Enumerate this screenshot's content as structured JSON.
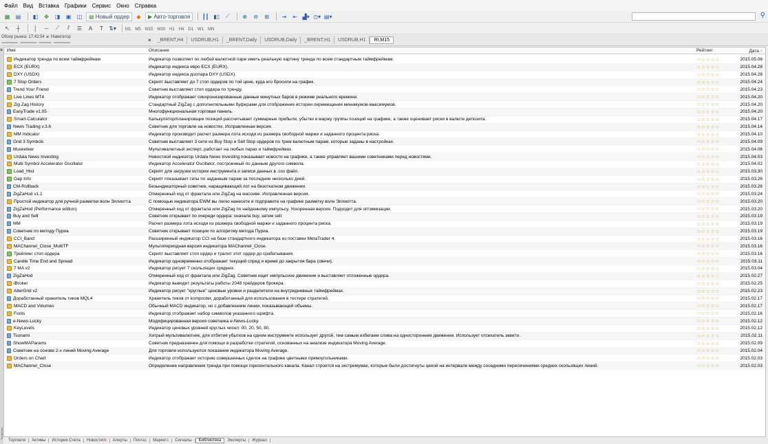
{
  "menu": [
    "Файл",
    "Вид",
    "Вставка",
    "Графики",
    "Сервис",
    "Окно",
    "Справка"
  ],
  "toolbar": {
    "new_order": "Новый ордер",
    "autotrading": "Авто-торговля"
  },
  "timeframes": [
    "M1",
    "M5",
    "M15",
    "M30",
    "H1",
    "H4",
    "D1",
    "W1",
    "MN"
  ],
  "panels": {
    "market_watch": "Обзор рынка: 17:42:54",
    "navigator": "Навигатор"
  },
  "chart_tabs": [
    "_BRENT,H4",
    "USDRUB,H1",
    "_BRENT,Daily",
    "USDRUB,Daily",
    "_BRENT,H1",
    "USDRUB,H1",
    "RI,M15"
  ],
  "table": {
    "headers": {
      "name": "Имя",
      "desc": "Описание",
      "rating": "Рейтинг",
      "date": "Дата"
    },
    "rating_stars": "☆☆☆☆☆",
    "rows": [
      {
        "type": "indicator",
        "name": "Индикатор тренда по всем таймфреймам",
        "desc": "Индикатор позволяет по любой валютной паре иметь реальную картину тренда по всем стандартным таймфреймам.",
        "date": "2015.05.06"
      },
      {
        "type": "indicator",
        "name": "ECX (EURX)",
        "desc": "Индикатор индекса евро ECX (EURX).",
        "date": "2015.04.28"
      },
      {
        "type": "indicator",
        "name": "DXY (USDX)",
        "desc": "Индикатор индекса доллара DXY (USDX).",
        "date": "2015.04.28"
      },
      {
        "type": "script",
        "name": "7 Stop Orders",
        "desc": "Скрипт выставляет до 7 стоп ордеров по той цене, куда его бросили на график.",
        "date": "2015.04.24"
      },
      {
        "type": "expert",
        "name": "Trend Your Friend",
        "desc": "Советник выставляет стоп ордера по тренду.",
        "date": "2015.04.23"
      },
      {
        "type": "indicator",
        "name": "Live Lines MT4",
        "desc": "Индикатор отображает синхронизированные данные минутных баров в режиме реального времени.",
        "date": "2015.04.20"
      },
      {
        "type": "indicator",
        "name": "Zig Zag History",
        "desc": "Стандартный ZigZag с дополнительными буферами для отображения истории перемещения минимумов-максимумов.",
        "date": "2015.04.20"
      },
      {
        "type": "expert",
        "name": "EasyTrade v1.05",
        "desc": "Многофункциональная торговая панель.",
        "date": "2015.04.20"
      },
      {
        "type": "indicator",
        "name": "Smart-Calculator",
        "desc": "Калькулятор/планировщик позиций рассчитывает суммарные прибыли, убытки и маржу группы позиций на графике, а также оценивает риски в валюте депозита.",
        "date": "2015.04.17"
      },
      {
        "type": "expert",
        "name": "News Trading v.3.6",
        "desc": "Советник для торговли на новостях. Исправленная версия.",
        "date": "2015.04.14"
      },
      {
        "type": "indicator",
        "name": "MM Indicator",
        "desc": "Индикатор производит расчет размера лота исходя из размера свободной маржи и заданного процента риска.",
        "date": "2015.04.10"
      },
      {
        "type": "expert",
        "name": "Grid 3 Symbols",
        "desc": "Советник выставляет 3 сети из Buy Stop и Sell Stop ордеров по трем валютным парам, которые заданы в настройках.",
        "date": "2015.04.09"
      },
      {
        "type": "expert",
        "name": "Musketeer",
        "desc": "Мультивалютный эксперт, работает на любых парах и таймфреймах.",
        "date": "2015.04.06"
      },
      {
        "type": "indicator",
        "name": "Urdala News Investing",
        "desc": "Новостной индикатор Urdala News Investing показывает новости на графике, а также управляет вашими советниками перед новостями.",
        "date": "2015.04.03"
      },
      {
        "type": "indicator",
        "name": "Multi Symbol Accelerator Oscillator",
        "desc": "Индикатор Accelerator Oscillator, построенный по данным другого символа.",
        "date": "2015.04.02"
      },
      {
        "type": "script",
        "name": "Load_Hist",
        "desc": "Скрипт для загрузки истории инструмента и записи данных в .csv файл.",
        "date": "2015.03.30"
      },
      {
        "type": "script",
        "name": "Gap Info",
        "desc": "Скрипт показывает гэпы по заданным парам за последние несколько дней.",
        "date": "2015.03.26"
      },
      {
        "type": "expert",
        "name": "CM-Rollback",
        "desc": "Безындикаторный советник, наращивающий лот на безоткатном движении.",
        "date": "2015.03.26"
      },
      {
        "type": "expert",
        "name": "ZigZaHod v1.1",
        "desc": "Отмеренный ход от фрактала или ZigZag на массиве. Исправленная версия.",
        "date": "2015.03.24"
      },
      {
        "type": "indicator",
        "name": "Простой индикатор для ручной разметки волн Эллиотта",
        "desc": "С помощью индикатора EWM вы легко нанесете и подправите на графике разметку волн Эллиотта.",
        "date": "2015.03.20"
      },
      {
        "type": "expert",
        "name": "ZigZaHod (Performance edition)",
        "desc": "Отмеренный ход от фрактала или ZigZag по найденному импульсу. Ускоренная версия. Подходит для оптимизации.",
        "date": "2015.03.20"
      },
      {
        "type": "expert",
        "name": "Buy and Sell",
        "desc": "Советник открывает по очереди ордера: сначала buy, затем sell.",
        "date": "2015.03.19"
      },
      {
        "type": "expert",
        "name": "MM",
        "desc": "Расчет размера лота исходя из размера свободной маржи и заданного процента риска.",
        "date": "2015.03.19"
      },
      {
        "type": "expert",
        "name": "Советник по методу Пуриа",
        "desc": "Советник открывает позиции по алгоритму метода Пуриа.",
        "date": "2015.03.19"
      },
      {
        "type": "indicator",
        "name": "CCI_Band",
        "desc": "Расширенный индикатор CCI на базе стандартного индикатора из поставки MetaTrader 4.",
        "date": "2015.03.16"
      },
      {
        "type": "indicator",
        "name": "MAChannel_Close_MultiTF",
        "desc": "Мультипериодная версия индикатора MAChannel_Close.",
        "date": "2015.03.16"
      },
      {
        "type": "script",
        "name": "Трейлинг стоп ордера",
        "desc": "Скрипт выставляет стоп ордер и тралит этот ордер до срабатывания.",
        "date": "2015.03.16"
      },
      {
        "type": "indicator",
        "name": "Candle Time End and Spread",
        "desc": "Индикатор одновременно отображает текущий спред и время до закрытия бара (свечи).",
        "date": "2015.03.11"
      },
      {
        "type": "indicator",
        "name": "7 MA v2",
        "desc": "Индикатор рисует 7 скользящих средних.",
        "date": "2015.03.04"
      },
      {
        "type": "expert",
        "name": "ZigZaHod",
        "desc": "Отмеренный ход от фрактала или ZigZag. Советник ищет импульсное движение и выставляет отложенные ордера.",
        "date": "2015.02.27"
      },
      {
        "type": "indicator",
        "name": "iBroker",
        "desc": "Индикатор выводит результаты работы 2048 трейдеров брокера.",
        "date": "2015.02.25"
      },
      {
        "type": "indicator",
        "name": "AlterGrid v2",
        "desc": "Индикатор рисует \"круглые\" ценовые уровни и разделители на внутридневных таймфреймах.",
        "date": "2015.02.23"
      },
      {
        "type": "expert",
        "name": "Доработанный хранитель тиков MQL4",
        "desc": "Хранитель тиков от komposter, доработанный для использования в тестере стратегий.",
        "date": "2015.02.17"
      },
      {
        "type": "indicator",
        "name": "MACD and Volumes",
        "desc": "Обычный MACD индикатор, но с добавлением линии, показывающей объемы.",
        "date": "2015.02.17"
      },
      {
        "type": "indicator",
        "name": "Fonts",
        "desc": "Индикатор отображает набор символов указанного шрифта.",
        "date": "2015.02.16"
      },
      {
        "type": "expert",
        "name": "e-News-Lucky",
        "desc": "Модифицированная версия советника e-News-Lucky.",
        "date": "2015.02.12"
      },
      {
        "type": "indicator",
        "name": "KeyLevels",
        "desc": "Индикатор ценовых уровней круглых чисел: 00, 20, 50, 80.",
        "date": "2015.02.12"
      },
      {
        "type": "expert",
        "name": "Tsunami",
        "desc": "Хитрый мультивалютник, для отбития убытков на одном инструменте использует другой, тем самым избегаем слива на одностороннем движении. Использует отсекатель эквити.",
        "date": "2015.02.11"
      },
      {
        "type": "expert",
        "name": "ShowMAParams",
        "desc": "Советник предназначен для помощи в разработке стратегий, основанных на анализе индикатора Moving Average.",
        "date": "2015.02.09"
      },
      {
        "type": "expert",
        "name": "Советник на основе 2-х линий Moving Average",
        "desc": "Для торговли используются показания индикатора Moving Average.",
        "date": "2015.02.04"
      },
      {
        "type": "indicator",
        "name": "Orders on Chart",
        "desc": "Индикатор отображает историю совершенных сделок на графике цветными прямоугольниками.",
        "date": "2015.02.03"
      },
      {
        "type": "indicator",
        "name": "MAChannel_Close",
        "desc": "Определение направления тренда при помощи горизонтального канала. Канал строится на экстремумах, которые были достигнуты ценой на интервале между соседними пересечениями средних скользящих линий.",
        "date": "2015.02.03"
      }
    ]
  },
  "bottom_tabs": [
    "Торговля",
    "Активы",
    "История Счета",
    "Новости",
    "Алерты",
    "Почта",
    "Маркет",
    "Сигналы",
    "Библиотека",
    "Эксперты",
    "Журнал"
  ],
  "bottom_active": "Библиотека",
  "badges": {
    "news": "99",
    "mail": "1",
    "market": "1"
  },
  "side_label": "Терминал"
}
